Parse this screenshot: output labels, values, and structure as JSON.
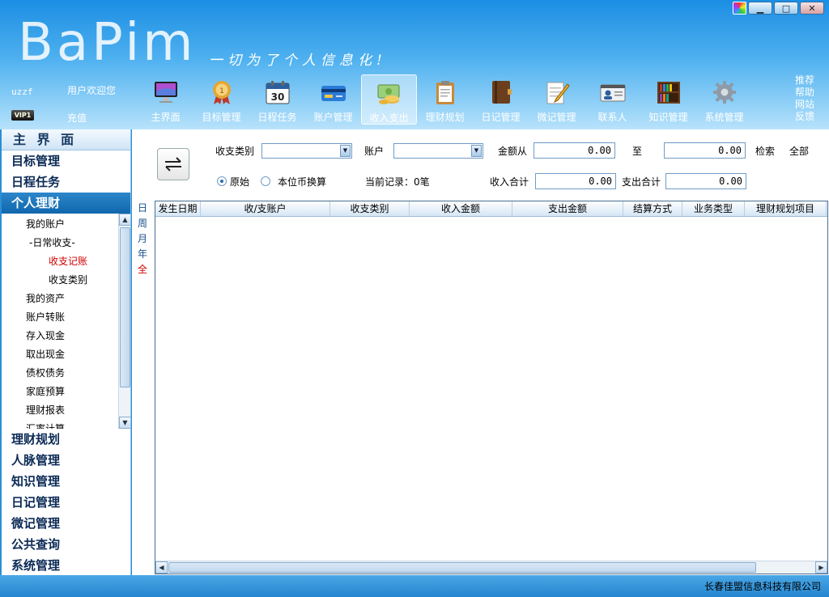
{
  "app": {
    "logo": "BaPim",
    "slogan": "一切为了个人信息化!"
  },
  "window_controls": [
    "skin",
    "minimize",
    "maximize",
    "close"
  ],
  "user": {
    "name": "uzzf",
    "welcome": "用户欢迎您",
    "vip": "VIP1",
    "recharge": "充值"
  },
  "toolbar": [
    {
      "label": "主界面",
      "icon": "monitor-icon"
    },
    {
      "label": "目标管理",
      "icon": "medal-icon"
    },
    {
      "label": "日程任务",
      "icon": "calendar-icon"
    },
    {
      "label": "账户管理",
      "icon": "card-icon"
    },
    {
      "label": "收入支出",
      "icon": "coins-icon",
      "active": true
    },
    {
      "label": "理财规划",
      "icon": "clipboard-icon"
    },
    {
      "label": "日记管理",
      "icon": "diary-icon"
    },
    {
      "label": "微记管理",
      "icon": "notepad-icon"
    },
    {
      "label": "联系人",
      "icon": "contact-card-icon"
    },
    {
      "label": "知识管理",
      "icon": "bookshelf-icon"
    },
    {
      "label": "系统管理",
      "icon": "gear-icon"
    }
  ],
  "side_links": [
    "推荐",
    "帮助",
    "网站",
    "反馈"
  ],
  "nav": {
    "title": "主 界 面",
    "top_items": [
      "目标管理",
      "日程任务",
      "个人理财"
    ],
    "active": "个人理财",
    "sub_items": [
      {
        "label": "我的账户",
        "level": 1
      },
      {
        "label": "-日常收支-",
        "level": 2
      },
      {
        "label": "收支记账",
        "level": 3,
        "current": true
      },
      {
        "label": "收支类别",
        "level": 3
      },
      {
        "label": "我的资产",
        "level": 1
      },
      {
        "label": "账户转账",
        "level": 1
      },
      {
        "label": "存入现金",
        "level": 1
      },
      {
        "label": "取出现金",
        "level": 1
      },
      {
        "label": "债权债务",
        "level": 1
      },
      {
        "label": "家庭预算",
        "level": 1
      },
      {
        "label": "理财报表",
        "level": 1
      },
      {
        "label": "汇率计算",
        "level": 1
      }
    ],
    "bottom_items": [
      "理财规划",
      "人脉管理",
      "知识管理",
      "日记管理",
      "微记管理",
      "公共查询",
      "系统管理"
    ]
  },
  "filters": {
    "category_label": "收支类别",
    "category_value": "",
    "account_label": "账户",
    "account_value": "",
    "amount_from_label": "金额从",
    "amount_from": "0.00",
    "to_label": "至",
    "amount_to": "0.00",
    "search_label": "检索",
    "all_label": "全部",
    "radio_original": "原始",
    "radio_local": "本位币换算",
    "current_records": "当前记录：0笔",
    "income_total_label": "收入合计",
    "income_total": "0.00",
    "expense_total_label": "支出合计",
    "expense_total": "0.00"
  },
  "periods": [
    "日",
    "周",
    "月",
    "年",
    "全"
  ],
  "current_period": "全",
  "table": {
    "columns": [
      "发生日期",
      "收/支账户",
      "收支类别",
      "收入金额",
      "支出金额",
      "结算方式",
      "业务类型",
      "理财规划项目"
    ],
    "rows": []
  },
  "status": {
    "company": "长春佳盟信息科技有限公司"
  }
}
